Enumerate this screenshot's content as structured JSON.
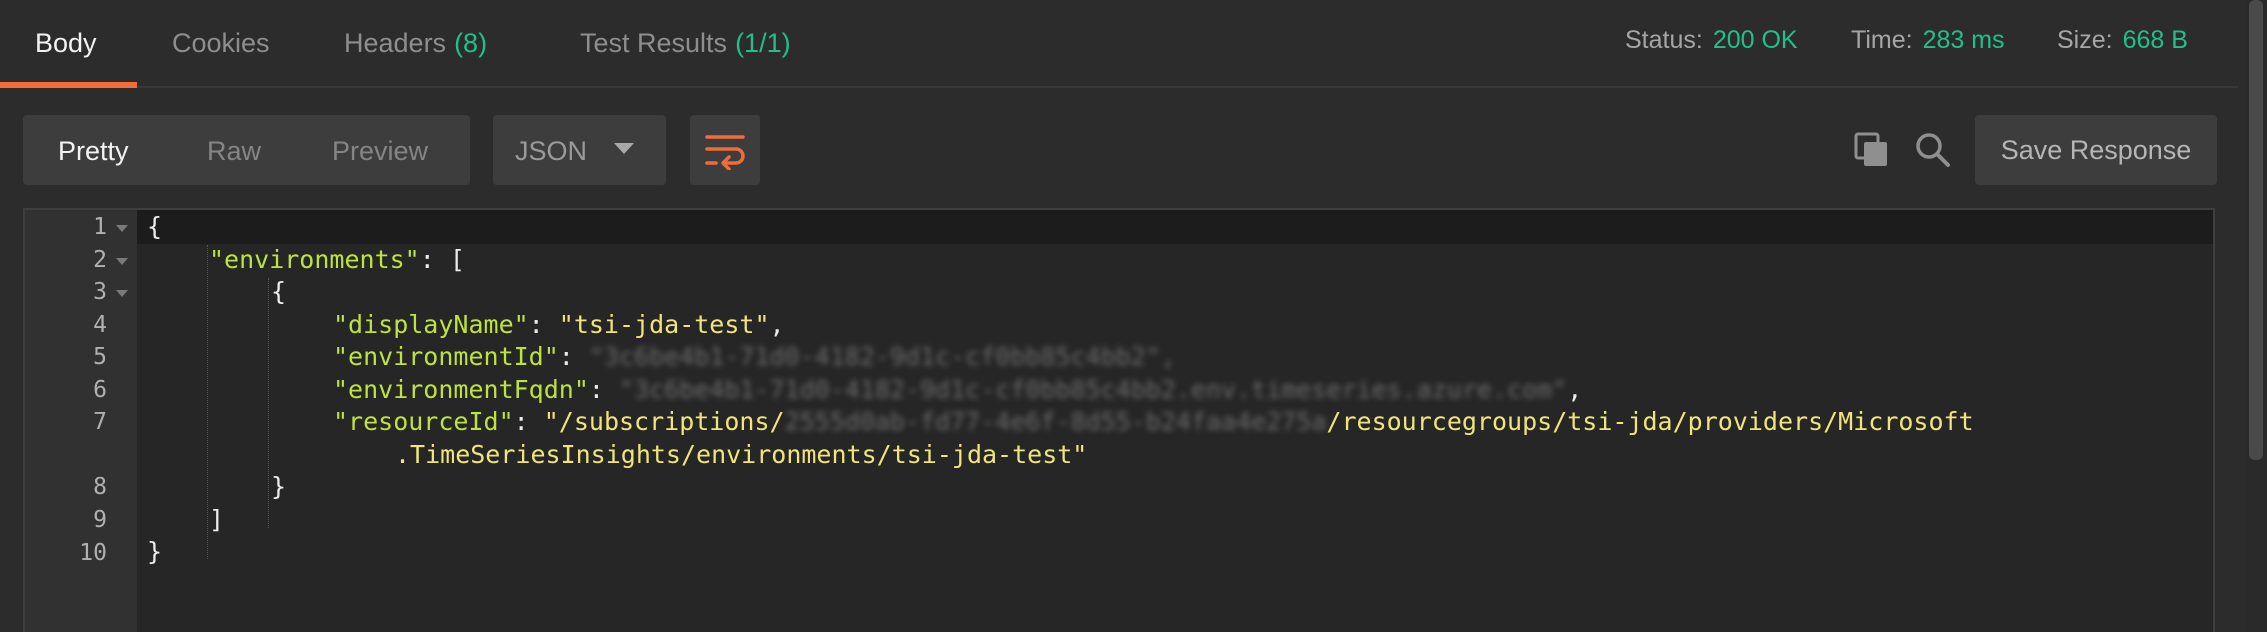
{
  "tabs": [
    {
      "label": "Body",
      "count": ""
    },
    {
      "label": "Cookies",
      "count": ""
    },
    {
      "label": "Headers",
      "count": "(8)"
    },
    {
      "label": "Test Results",
      "count": "(1/1)"
    }
  ],
  "status": {
    "label": "Status:",
    "value": "200 OK"
  },
  "time": {
    "label": "Time:",
    "value": "283 ms"
  },
  "size": {
    "label": "Size:",
    "value": "668 B"
  },
  "view_modes": [
    "Pretty",
    "Raw",
    "Preview"
  ],
  "format": {
    "selected": "JSON"
  },
  "icons": {
    "wrap": "wrap-lines-icon",
    "copy": "copy-icon",
    "search": "search-icon"
  },
  "save_label": "Save Response",
  "line_numbers": [
    "1",
    "2",
    "3",
    "4",
    "5",
    "6",
    "7",
    "8",
    "9",
    "10"
  ],
  "code": {
    "open_brace": "{",
    "environments_key": "\"environments\"",
    "colon_open_bracket": ": [",
    "obj_open": "{",
    "displayName_key": "\"displayName\"",
    "displayName_value": "\"tsi-jda-test\"",
    "environmentId_key": "\"environmentId\"",
    "environmentId_value": "\"3c6be4b1-71d0-4182-9d1c-cf0bb85c4bb2\"",
    "environmentFqdn_key": "\"environmentFqdn\"",
    "environmentFqdn_value": "\"3c6be4b1-71d0-4182-9d1c-cf0bb85c4bb2.env.timeseries.azure.com\"",
    "resourceId_key": "\"resourceId\"",
    "resourceId_prefix": "\"/subscriptions/",
    "resourceId_blurred": "2555d0ab-fd77-4e6f-8d55-b24faa4e275a",
    "resourceId_suffix": "/resourcegroups/tsi-jda/providers/Microsoft",
    "resourceId_cont": ".TimeSeriesInsights/environments/tsi-jda-test\"",
    "obj_close": "}",
    "array_close": "]",
    "close_brace": "}",
    "comma": ",",
    "colon": ": "
  },
  "colors": {
    "accent": "#f26b3a",
    "status_green": "#21c08b",
    "json_key": "#bde33f",
    "json_string": "#f1e47b",
    "background": "#2c2c2c"
  }
}
